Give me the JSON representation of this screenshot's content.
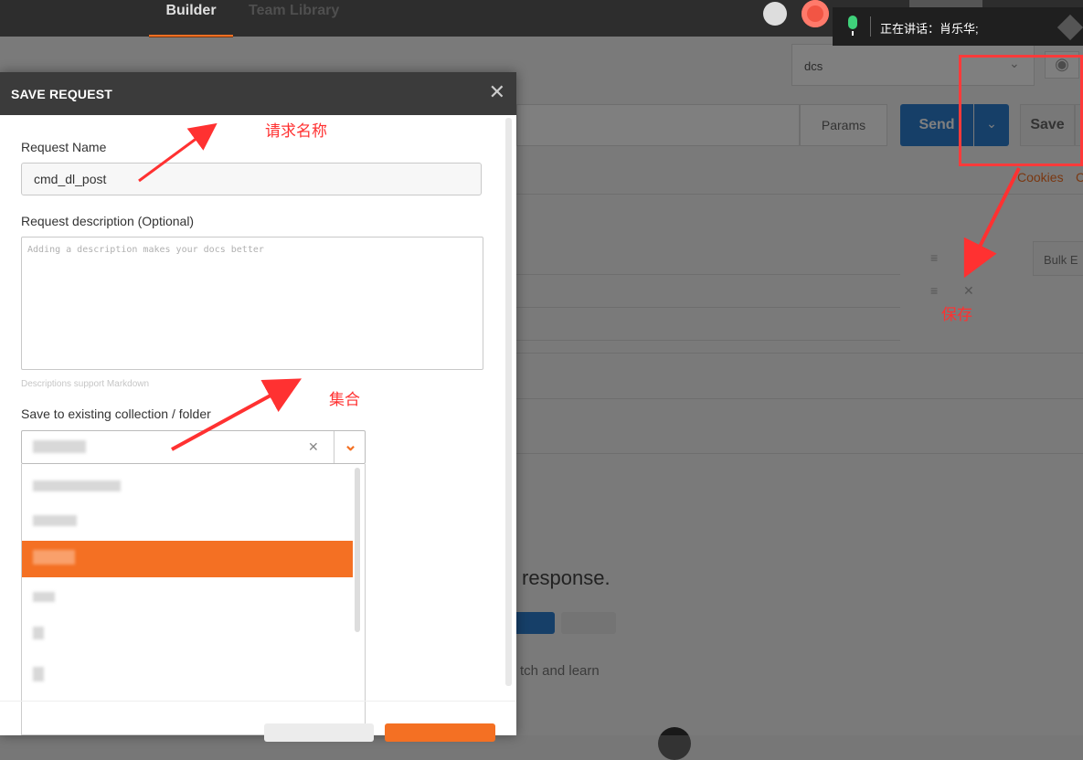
{
  "app": {
    "tabs": [
      {
        "label": "Builder"
      },
      {
        "label": "Team Library"
      }
    ],
    "env_select": "dcs",
    "params_label": "Params",
    "send_label": "Send",
    "save_label": "Save",
    "cookies_label": "Cookies",
    "cookies_trailing": "C",
    "bulk_edit_label": "Bulk E",
    "response_text": "response.",
    "learn_text": "tch and learn"
  },
  "call_notice": {
    "text": "正在讲话：肖乐华;"
  },
  "modal": {
    "title": "SAVE REQUEST",
    "request_name_label": "Request Name",
    "request_name_value": "cmd_dl_post",
    "description_label": "Request description (Optional)",
    "description_placeholder": "Adding a description makes your docs better",
    "markdown_hint": "Descriptions support Markdown",
    "collection_label": "Save to existing collection / folder"
  },
  "annotations": {
    "request_name": "请求名称",
    "collection": "集合",
    "save": "保存"
  },
  "colors": {
    "accent": "#f47023",
    "send_blue": "#2c7fd0",
    "annotation_red": "#ff3131"
  }
}
